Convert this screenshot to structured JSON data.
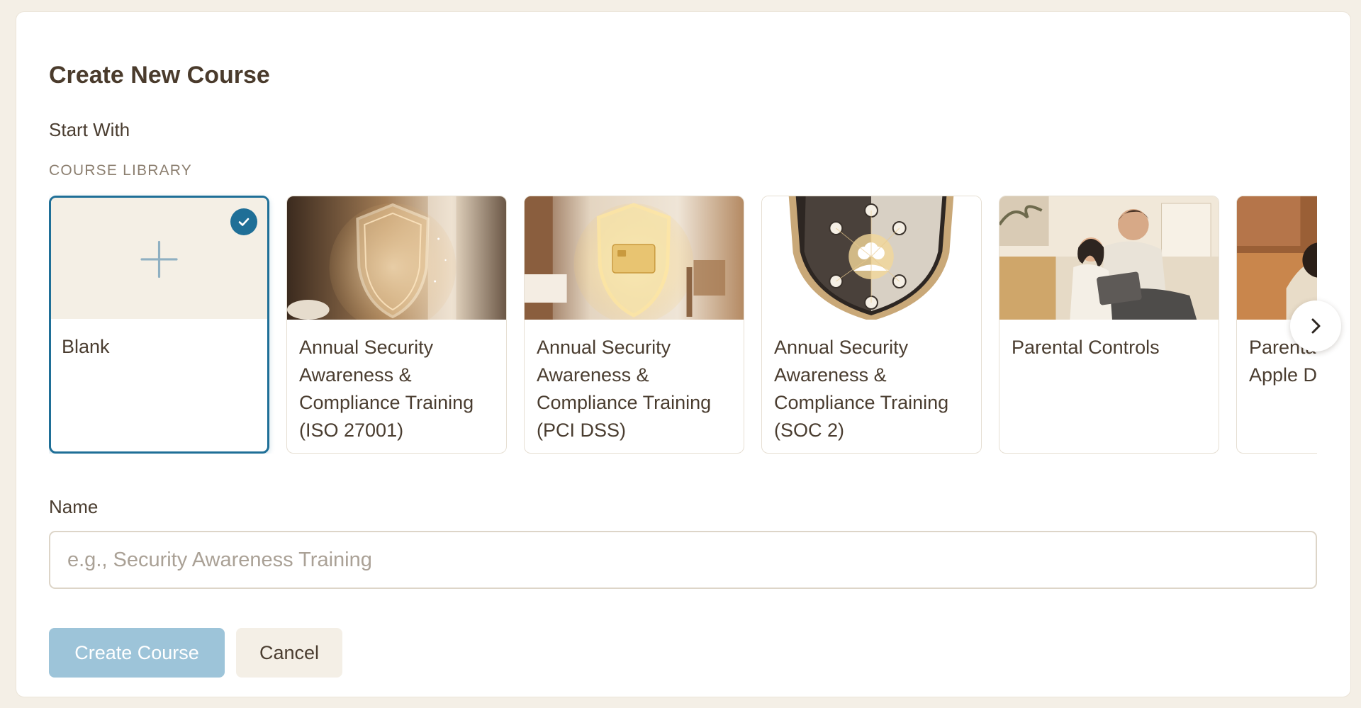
{
  "dialog": {
    "title": "Create New Course",
    "start_with_label": "Start With",
    "library_label": "COURSE LIBRARY"
  },
  "library": {
    "cards": [
      {
        "label": "Blank",
        "selected": true,
        "icon": "plus-icon"
      },
      {
        "label": "Annual Security Awareness & Compliance Training (ISO 27001)",
        "selected": false
      },
      {
        "label": "Annual Security Awareness & Compliance Training (PCI DSS)",
        "selected": false
      },
      {
        "label": "Annual Security Awareness & Compliance Training (SOC 2)",
        "selected": false
      },
      {
        "label": "Parental Controls",
        "selected": false
      },
      {
        "label": "Parental Controls Apple Devices",
        "selected": false
      }
    ],
    "next_icon": "chevron-right-icon"
  },
  "name_field": {
    "label": "Name",
    "placeholder": "e.g., Security Awareness Training",
    "value": ""
  },
  "actions": {
    "create_label": "Create Course",
    "cancel_label": "Cancel"
  },
  "colors": {
    "accent": "#1f6f97",
    "create_button": "#9dc4d9",
    "cancel_button": "#f4efe6",
    "page_background": "#f4efe6"
  }
}
